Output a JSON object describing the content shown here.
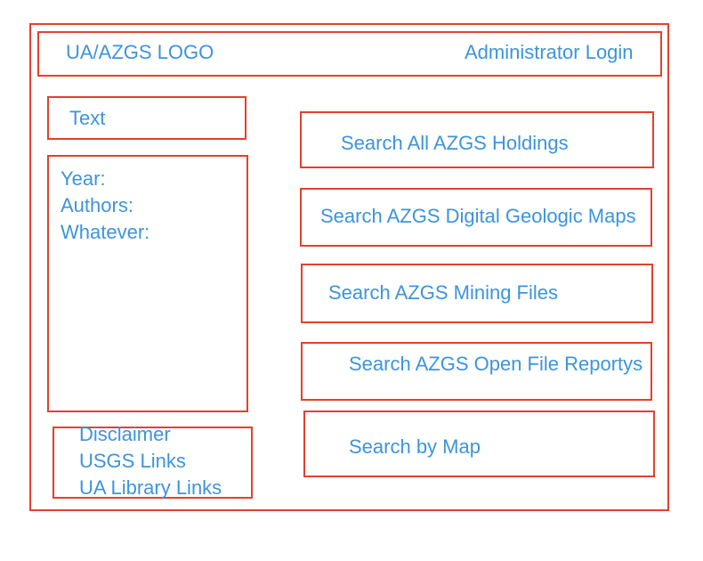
{
  "header": {
    "logo": "UA/AZGS LOGO",
    "login": "Administrator Login"
  },
  "sidebar": {
    "text": "Text",
    "fields": [
      "Year:",
      "Authors:",
      "Whatever:"
    ],
    "links": [
      "Disclaimer",
      "USGS Links",
      "UA Library Links"
    ]
  },
  "searches": [
    "Search All AZGS Holdings",
    "Search AZGS Digital Geologic Maps",
    "Search AZGS Mining Files",
    "Search AZGS Open File Reportys",
    "Search by Map"
  ],
  "colors": {
    "border": "#e2412e",
    "text": "#3d94dc"
  }
}
